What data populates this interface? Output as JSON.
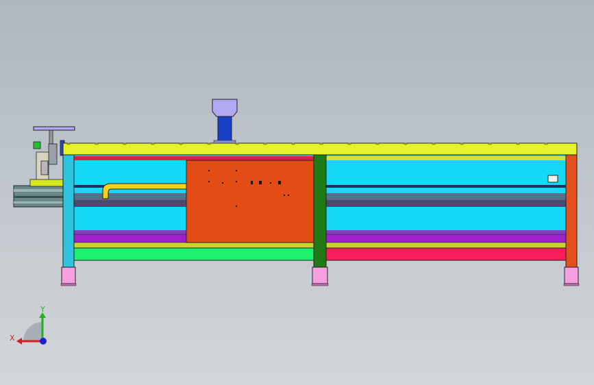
{
  "viewport": {
    "background": [
      "#aeb6bf",
      "#d3d6d9"
    ]
  },
  "triad": {
    "x_label": "X",
    "y_label": "Y",
    "x_color": "#d42020",
    "y_color": "#20b020",
    "z_color": "#2020d0"
  },
  "model": {
    "colors": {
      "top_rail": "#e4f22a",
      "frame_fill": "#14d8f6",
      "center_panel": "#e24b14",
      "column_dark_green": "#1f7a16",
      "column_left": "#2ec4e0",
      "column_right": "#e2501c",
      "bottom_green": "#1ef070",
      "bottom_red": "#f81c5c",
      "purple_strip": "#a020c8",
      "olive_strip": "#c8d42c",
      "yellow_pipe": "#f2d21a",
      "foot": "#f2a0e0",
      "motor_top": "#b0a8f2",
      "motor_body": "#1a3ec8",
      "guide_rail": "#6a8a8a"
    }
  }
}
